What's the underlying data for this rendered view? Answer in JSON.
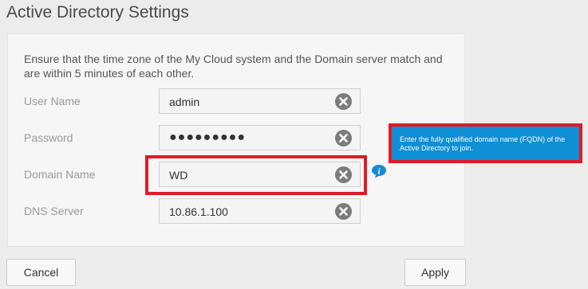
{
  "page": {
    "title": "Active Directory Settings",
    "intro": "Ensure that the time zone of the My Cloud system and the Domain server match and are within 5 minutes of each other."
  },
  "form": {
    "username": {
      "label": "User Name",
      "value": "admin"
    },
    "password": {
      "label": "Password",
      "value": "●●●●●●●●●"
    },
    "domain": {
      "label": "Domain Name",
      "value": "WD"
    },
    "dns": {
      "label": "DNS Server",
      "value": "10.86.1.100"
    }
  },
  "tooltip": {
    "text": "Enter the fully qualified domain name (FQDN) of the Active Directory to join."
  },
  "buttons": {
    "cancel": "Cancel",
    "apply": "Apply"
  },
  "icons": {
    "clear": "clear-x-icon",
    "info": "info-icon"
  },
  "colors": {
    "highlight": "#e01b24",
    "tooltip_bg": "#0f8fd6",
    "clear_icon": "#7c7c7c",
    "info_icon": "#1a8ad4"
  }
}
